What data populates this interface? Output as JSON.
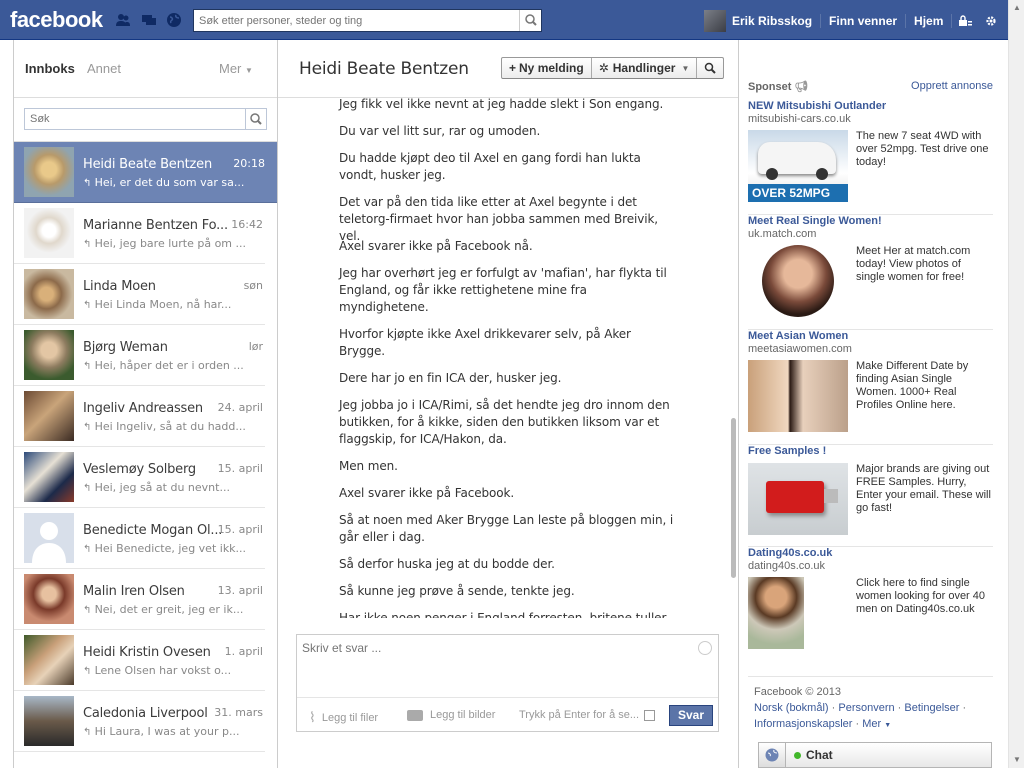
{
  "header": {
    "logo": "facebook",
    "search_placeholder": "Søk etter personer, steder og ting",
    "user_name": "Erik Ribsskog",
    "find_friends": "Finn venner",
    "home": "Hjem"
  },
  "inbox": {
    "tab_inbox": "Innboks",
    "tab_other": "Annet",
    "more": "Mer",
    "search_placeholder": "Søk",
    "threads": [
      {
        "name": "Heidi Beate Bentzen",
        "date": "20:18",
        "snippet": "Hei, er det du som var sa...",
        "selected": true
      },
      {
        "name": "Marianne Bentzen Fo...",
        "date": "16:42",
        "snippet": "Hei, jeg bare lurte på om ..."
      },
      {
        "name": "Linda Moen",
        "date": "søn",
        "snippet": "Hei Linda Moen, nå har..."
      },
      {
        "name": "Bjørg Weman",
        "date": "lør",
        "snippet": "Hei, håper det er i orden ..."
      },
      {
        "name": "Ingeliv Andreassen",
        "date": "24. april",
        "snippet": "Hei Ingeliv, så at du hadd..."
      },
      {
        "name": "Veslemøy Solberg",
        "date": "15. april",
        "snippet": "Hei, jeg så at du nevnt..."
      },
      {
        "name": "Benedicte Mogan Ol...",
        "date": "15. april",
        "snippet": "Hei Benedicte, jeg vet ikk..."
      },
      {
        "name": "Malin Iren Olsen",
        "date": "13. april",
        "snippet": "Nei, det er greit, jeg er ik..."
      },
      {
        "name": "Heidi Kristin Ovesen",
        "date": "1. april",
        "snippet": "Lene Olsen har vokst o..."
      },
      {
        "name": "Caledonia Liverpool",
        "date": "31. mars",
        "snippet": "Hi Laura, I was at your p..."
      }
    ]
  },
  "conversation": {
    "title": "Heidi Beate Bentzen",
    "new_message": "Ny melding",
    "actions": "Handlinger",
    "messages": [
      "Jeg fikk vel ikke nevnt at jeg hadde slekt i Son engang.",
      "Du var vel litt sur, rar og umoden.",
      "Du hadde kjøpt deo til Axel en gang fordi han lukta vondt, husker jeg.",
      "Det var på den tida like etter at Axel begynte i det teletorg-firmaet hvor han jobba sammen med Breivik, vel.",
      "Axel svarer ikke på Facebook nå.",
      "Jeg har overhørt jeg er forfulgt av 'mafian', har flykta til England, og får ikke rettighetene mine fra myndighetene.",
      "Hvorfor kjøpte ikke Axel drikkevarer selv, på Aker Brygge.",
      "Dere har jo en fin ICA der, husker jeg.",
      "Jeg jobba jo i ICA/Rimi, så det hendte jeg dro innom den butikken, for å kikke, siden den butikken liksom var et flaggskip, for ICA/Hakon, da.",
      "Men men.",
      "Axel svarer ikke på Facebook.",
      "Så at noen med Aker Brygge Lan leste på bloggen min, i går eller i dag.",
      "Så derfor huska jeg at du bodde der.",
      "Så kunne jeg prøve å sende, tenkte jeg.",
      "Har ikke noen penger i England forresten, britene tuller bare med meg, må jeg si."
    ],
    "reply_placeholder": "Skriv et svar ...",
    "add_files": "Legg til filer",
    "add_photos": "Legg til bilder",
    "enter_to_send": "Trykk på Enter for å se...",
    "send": "Svar"
  },
  "sidebar": {
    "sponsored": "Sponset",
    "create_ad": "Opprett annonse",
    "ads": [
      {
        "title": "NEW Mitsubishi Outlander",
        "url": "mitsubishi-cars.co.uk",
        "body": "The new 7 seat 4WD with over 52mpg. Test drive one today!",
        "img_label": "OVER 52MPG"
      },
      {
        "title": "Meet Real Single Women!",
        "url": "uk.match.com",
        "body": "Meet Her at match.com today! View photos of single women for free!"
      },
      {
        "title": "Meet Asian Women",
        "url": "meetasiawomen.com",
        "body": "Make Different Date by finding Asian Single Women. 1000+ Real Profiles Online here."
      },
      {
        "title": "Free Samples !",
        "url": "",
        "body": "Major brands are giving out FREE Samples. Hurry, Enter your email. These will go fast!"
      },
      {
        "title": "Dating40s.co.uk",
        "url": "dating40s.co.uk",
        "body": "Click here to find single women looking for over 40 men on Dating40s.co.uk"
      }
    ],
    "footer": {
      "copyright": "Facebook © 2013",
      "links": [
        "Norsk (bokmål)",
        "Personvern",
        "Betingelser",
        "Informasjonskapsler",
        "Mer"
      ]
    },
    "chat": "Chat"
  },
  "colors": {
    "brand": "#3b5998",
    "selected": "#6d84b4"
  }
}
